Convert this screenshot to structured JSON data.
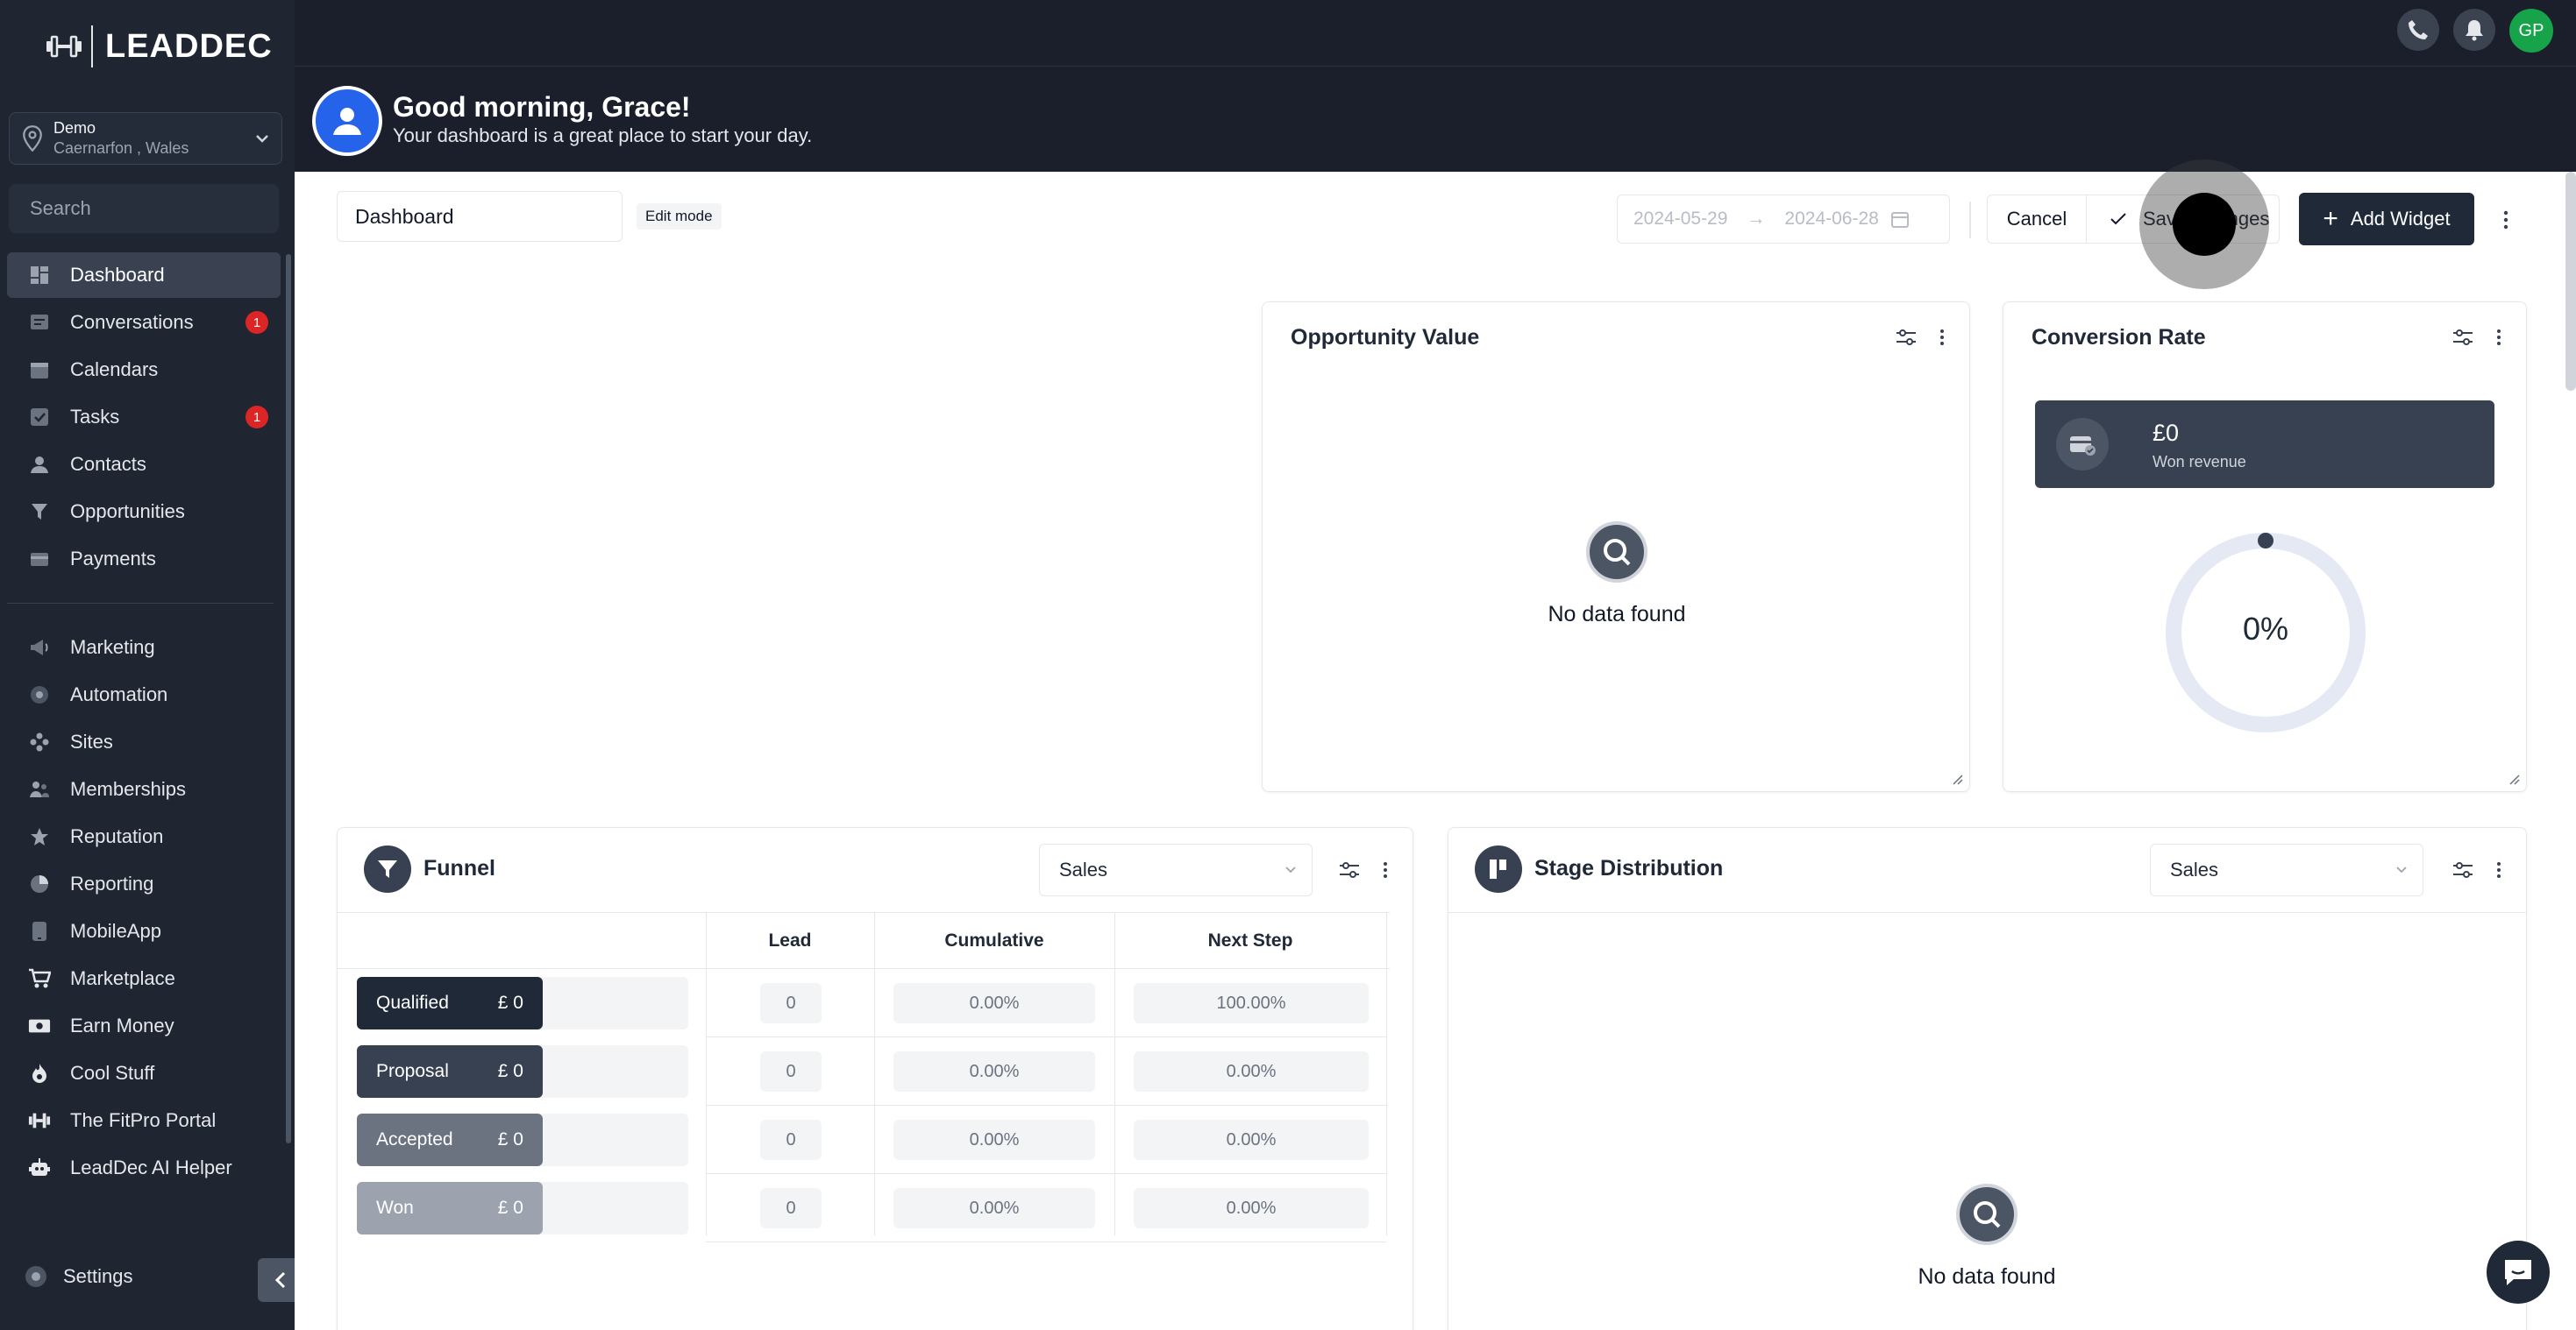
{
  "app": {
    "brand": "LEADDEC"
  },
  "location": {
    "name": "Demo",
    "sub": "Caernarfon , Wales"
  },
  "search": {
    "placeholder": "Search"
  },
  "nav": [
    {
      "label": "Dashboard",
      "icon": "dashboard-icon",
      "active": true
    },
    {
      "label": "Conversations",
      "icon": "chat-icon",
      "badge": "1"
    },
    {
      "label": "Calendars",
      "icon": "calendar-icon"
    },
    {
      "label": "Tasks",
      "icon": "check-square-icon",
      "badge": "1"
    },
    {
      "label": "Contacts",
      "icon": "user-icon"
    },
    {
      "label": "Opportunities",
      "icon": "funnel-icon"
    },
    {
      "label": "Payments",
      "icon": "card-icon"
    }
  ],
  "nav2": [
    {
      "label": "Marketing",
      "icon": "megaphone-icon"
    },
    {
      "label": "Automation",
      "icon": "automation-icon"
    },
    {
      "label": "Sites",
      "icon": "sites-icon"
    },
    {
      "label": "Memberships",
      "icon": "memberships-icon"
    },
    {
      "label": "Reputation",
      "icon": "star-icon"
    },
    {
      "label": "Reporting",
      "icon": "pie-icon"
    },
    {
      "label": "MobileApp",
      "icon": "mobile-icon"
    },
    {
      "label": "Marketplace",
      "icon": "cart-icon"
    },
    {
      "label": "Earn Money",
      "icon": "money-icon"
    },
    {
      "label": "Cool Stuff",
      "icon": "flame-icon"
    },
    {
      "label": "The FitPro Portal",
      "icon": "dumbbell-icon"
    },
    {
      "label": "LeadDec AI Helper",
      "icon": "robot-icon"
    }
  ],
  "settings_label": "Settings",
  "topbar": {
    "avatar_initials": "GP"
  },
  "greeting": {
    "title": "Good morning, Grace!",
    "subtitle": "Your dashboard is a great place to start your day."
  },
  "toolbar": {
    "dashboard_name": "Dashboard",
    "edit_mode": "Edit mode",
    "date_start": "2024-05-29",
    "date_end": "2024-06-28",
    "cancel": "Cancel",
    "save": "Save Changes",
    "add_widget": "Add Widget"
  },
  "widgets": {
    "opportunity_value": {
      "title": "Opportunity Value",
      "empty": "No data found"
    },
    "conversion_rate": {
      "title": "Conversion Rate",
      "won_value": "£0",
      "won_label": "Won revenue",
      "percent": "0%"
    },
    "funnel": {
      "title": "Funnel",
      "select": "Sales",
      "headers": [
        "Lead",
        "Cumulative",
        "Next Step"
      ],
      "rows": [
        {
          "stage": "Qualified",
          "amount": "£ 0",
          "lead": "0",
          "cumulative": "0.00%",
          "next": "100.00%",
          "color": "#1f2937"
        },
        {
          "stage": "Proposal",
          "amount": "£ 0",
          "lead": "0",
          "cumulative": "0.00%",
          "next": "0.00%",
          "color": "#374151"
        },
        {
          "stage": "Accepted",
          "amount": "£ 0",
          "lead": "0",
          "cumulative": "0.00%",
          "next": "0.00%",
          "color": "#6b7280"
        },
        {
          "stage": "Won",
          "amount": "£ 0",
          "lead": "0",
          "cumulative": "0.00%",
          "next": "0.00%",
          "color": "#9ca3af"
        }
      ]
    },
    "stage_distribution": {
      "title": "Stage Distribution",
      "select": "Sales",
      "empty": "No data found"
    }
  }
}
